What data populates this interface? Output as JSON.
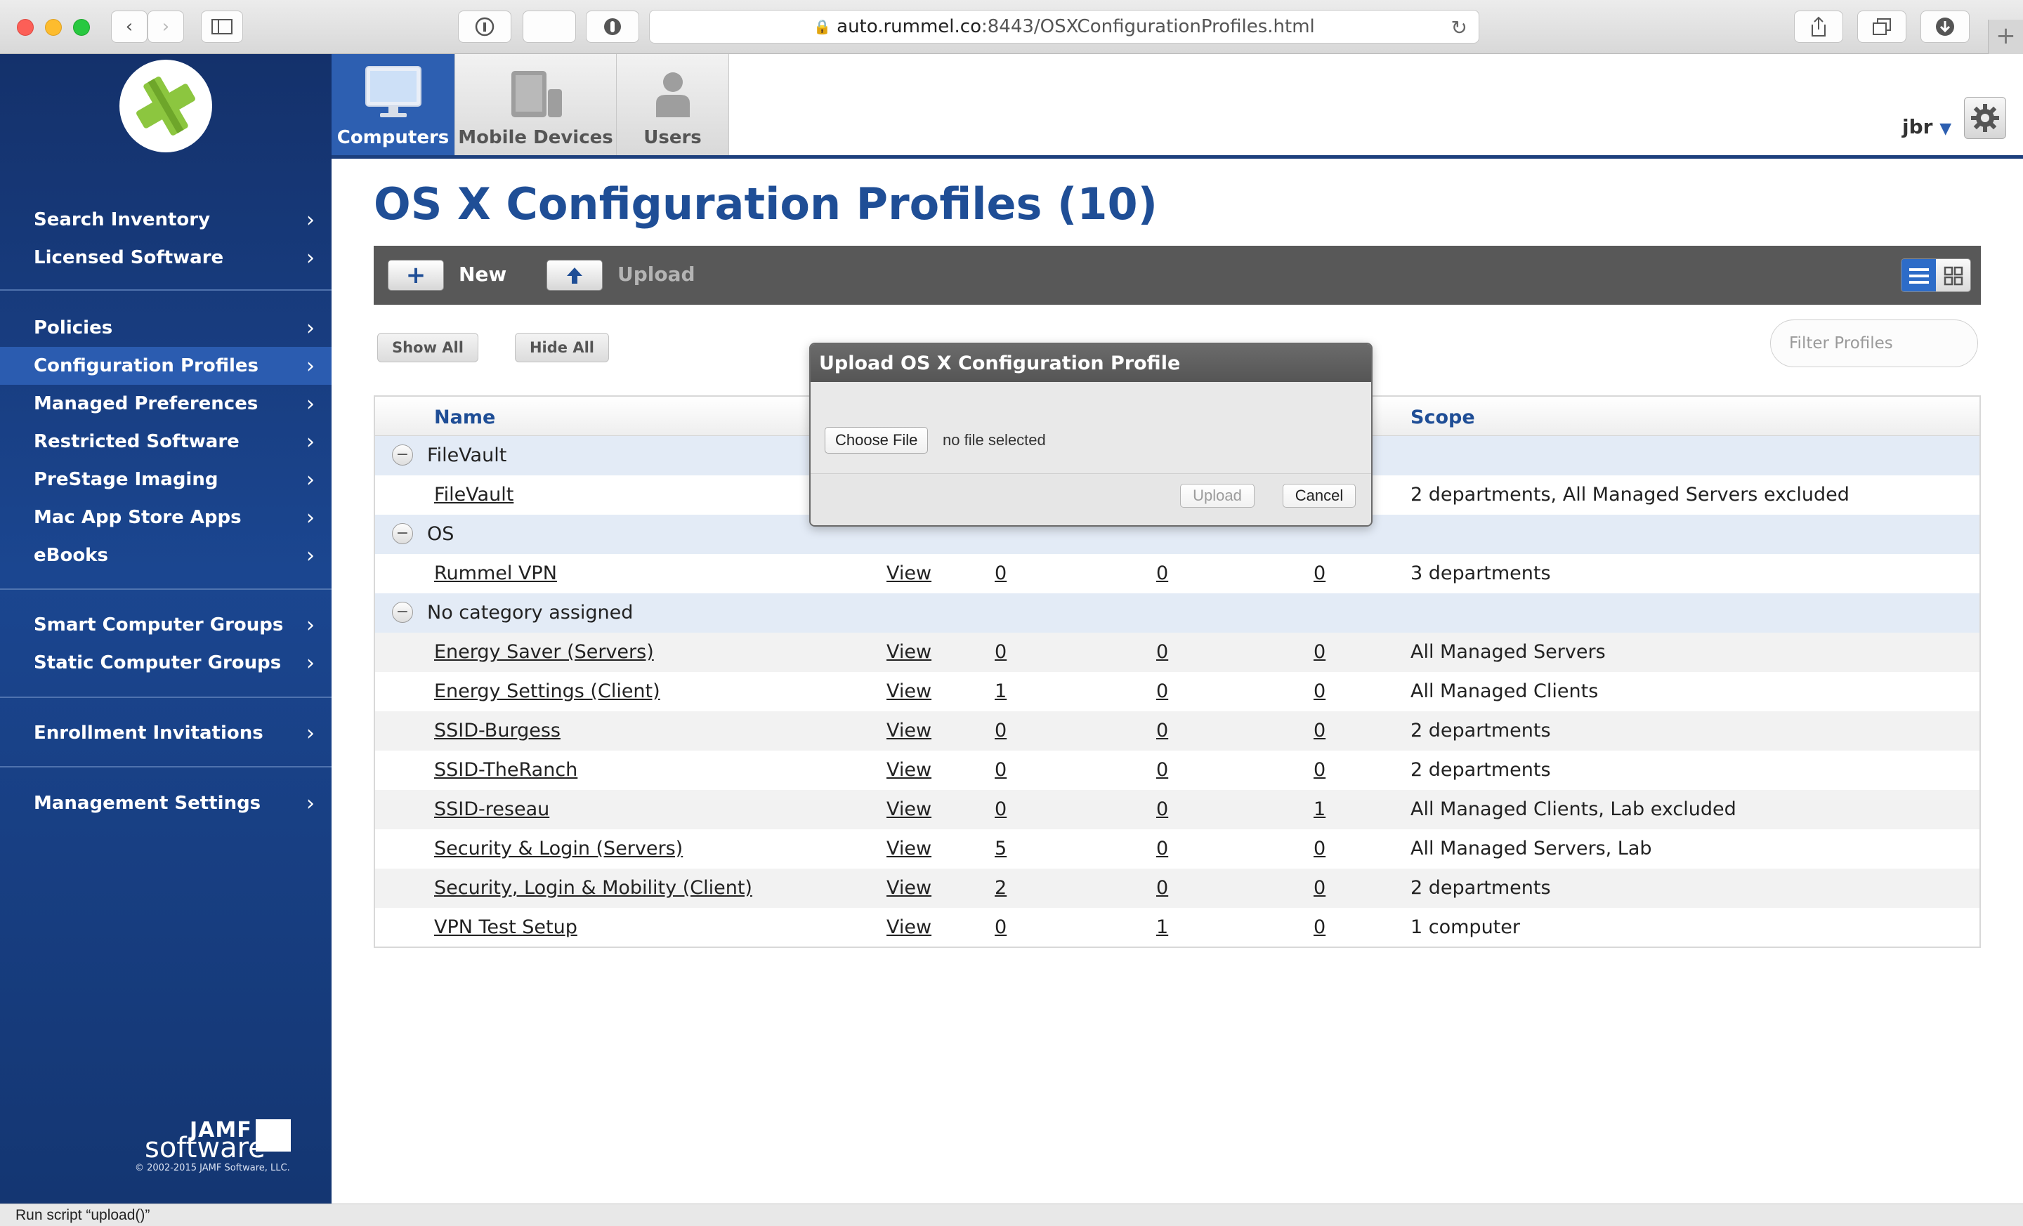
{
  "browser": {
    "url_host": "auto.rummel.co",
    "url_path": ":8443/OSXConfigurationProfiles.html",
    "status_text": "Run script “upload()”"
  },
  "sidebar": {
    "groups": [
      [
        "Search Inventory",
        "Licensed Software"
      ],
      [
        "Policies",
        "Configuration Profiles",
        "Managed Preferences",
        "Restricted Software",
        "PreStage Imaging",
        "Mac App Store Apps",
        "eBooks"
      ],
      [
        "Smart Computer Groups",
        "Static Computer Groups"
      ],
      [
        "Enrollment Invitations"
      ],
      [
        "Management Settings"
      ]
    ],
    "active_item": "Configuration Profiles",
    "footer": {
      "brand_top": "JAMF",
      "brand_bottom": "software",
      "copyright": "© 2002-2015 JAMF Software, LLC."
    }
  },
  "tabs": [
    {
      "label": "Computers",
      "icon": "computer-icon",
      "active": true
    },
    {
      "label": "Mobile Devices",
      "icon": "mobile-devices-icon",
      "active": false
    },
    {
      "label": "Users",
      "icon": "user-icon",
      "active": false
    }
  ],
  "user": {
    "name": "jbr",
    "caret": "▼"
  },
  "page": {
    "title": "OS X Configuration Profiles (10)"
  },
  "toolbar": {
    "new_label": "New",
    "upload_label": "Upload"
  },
  "actions": {
    "show_all": "Show All",
    "hide_all": "Hide All"
  },
  "filter": {
    "placeholder": "Filter Profiles"
  },
  "table": {
    "columns": {
      "name": "Name",
      "scope": "Scope"
    },
    "rows": [
      {
        "type": "category",
        "label": "FileVault"
      },
      {
        "type": "item",
        "name": "FileVault",
        "view": "",
        "c1": "",
        "c2": "",
        "c3": "",
        "scope": "2 departments, All Managed Servers excluded"
      },
      {
        "type": "category",
        "label": "OS"
      },
      {
        "type": "item",
        "name": "Rummel VPN",
        "view": "View",
        "c1": "0",
        "c2": "0",
        "c3": "0",
        "scope": "3 departments"
      },
      {
        "type": "category",
        "label": "No category assigned"
      },
      {
        "type": "item",
        "name": "Energy Saver (Servers)",
        "view": "View",
        "c1": "0",
        "c2": "0",
        "c3": "0",
        "scope": "All Managed Servers"
      },
      {
        "type": "item",
        "name": "Energy Settings (Client)",
        "view": "View",
        "c1": "1",
        "c2": "0",
        "c3": "0",
        "scope": "All Managed Clients"
      },
      {
        "type": "item",
        "name": "SSID-Burgess",
        "view": "View",
        "c1": "0",
        "c2": "0",
        "c3": "0",
        "scope": "2 departments"
      },
      {
        "type": "item",
        "name": "SSID-TheRanch",
        "view": "View",
        "c1": "0",
        "c2": "0",
        "c3": "0",
        "scope": "2 departments"
      },
      {
        "type": "item",
        "name": "SSID-reseau",
        "view": "View",
        "c1": "0",
        "c2": "0",
        "c3": "1",
        "scope": "All Managed Clients, Lab excluded"
      },
      {
        "type": "item",
        "name": "Security & Login (Servers)",
        "view": "View",
        "c1": "5",
        "c2": "0",
        "c3": "0",
        "scope": "All Managed Servers, Lab"
      },
      {
        "type": "item",
        "name": "Security, Login & Mobility (Client)",
        "view": "View",
        "c1": "2",
        "c2": "0",
        "c3": "0",
        "scope": "2 departments"
      },
      {
        "type": "item",
        "name": "VPN Test Setup",
        "view": "View",
        "c1": "0",
        "c2": "1",
        "c3": "0",
        "scope": "1 computer"
      }
    ]
  },
  "modal": {
    "title": "Upload OS X Configuration Profile",
    "choose_file": "Choose File",
    "no_file": "no file selected",
    "upload": "Upload",
    "cancel": "Cancel"
  },
  "colors": {
    "brand_blue": "#1f4e96",
    "sidebar_active": "#2b5cb0",
    "logo_green": "#8cc63f"
  }
}
